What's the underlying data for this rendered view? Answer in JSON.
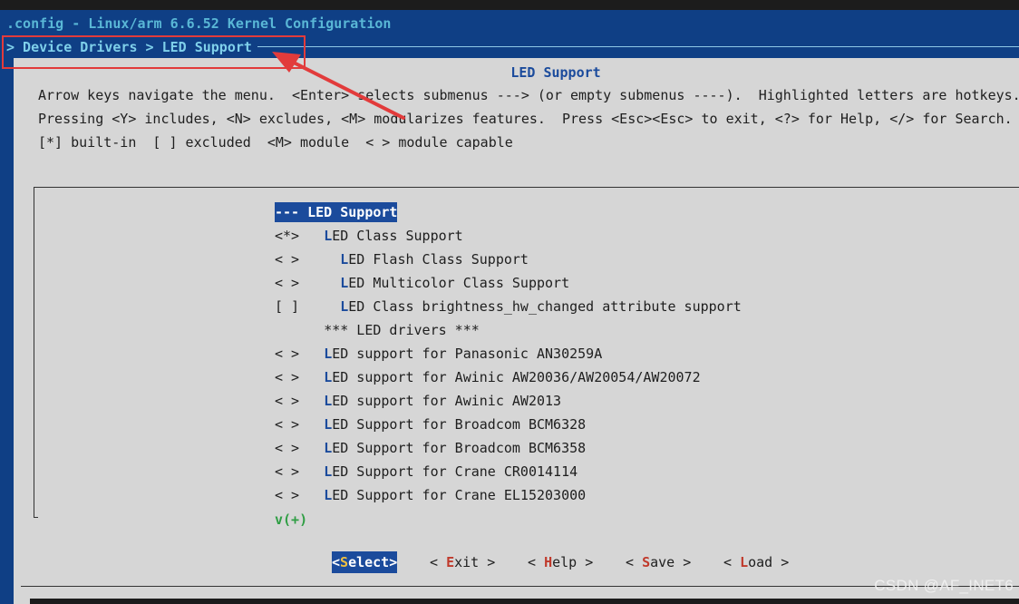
{
  "window": {
    "title": ".config - Linux/arm 6.6.52 Kernel Configuration",
    "breadcrumb": "> Device Drivers > LED Support"
  },
  "dialog": {
    "title": "LED Support",
    "help_lines": [
      "Arrow keys navigate the menu.  <Enter> selects submenus ---> (or empty submenus ----).  Highlighted letters are hotkeys.",
      "Pressing <Y> includes, <N> excludes, <M> modularizes features.  Press <Esc><Esc> to exit, <?> for Help, </> for Search.",
      "[*] built-in  [ ] excluded  <M> module  < > module capable"
    ]
  },
  "menu": {
    "items": [
      {
        "prefix": "--- ",
        "hotkey": "",
        "rest": "LED Support",
        "selected": true
      },
      {
        "prefix": "<*>   ",
        "hotkey": "L",
        "rest": "ED Class Support"
      },
      {
        "prefix": "< >     ",
        "hotkey": "L",
        "rest": "ED Flash Class Support"
      },
      {
        "prefix": "< >     ",
        "hotkey": "L",
        "rest": "ED Multicolor Class Support"
      },
      {
        "prefix": "[ ]     ",
        "hotkey": "L",
        "rest": "ED Class brightness_hw_changed attribute support"
      },
      {
        "prefix": "      ",
        "hotkey": "",
        "rest": "*** LED drivers ***"
      },
      {
        "prefix": "< >   ",
        "hotkey": "L",
        "rest": "ED support for Panasonic AN30259A"
      },
      {
        "prefix": "< >   ",
        "hotkey": "L",
        "rest": "ED support for Awinic AW20036/AW20054/AW20072"
      },
      {
        "prefix": "< >   ",
        "hotkey": "L",
        "rest": "ED support for Awinic AW2013"
      },
      {
        "prefix": "< >   ",
        "hotkey": "L",
        "rest": "ED Support for Broadcom BCM6328"
      },
      {
        "prefix": "< >   ",
        "hotkey": "L",
        "rest": "ED Support for Broadcom BCM6358"
      },
      {
        "prefix": "< >   ",
        "hotkey": "L",
        "rest": "ED Support for Crane CR0014114"
      },
      {
        "prefix": "< >   ",
        "hotkey": "L",
        "rest": "ED Support for Crane EL15203000"
      }
    ],
    "more_indicator": "v(+)"
  },
  "buttons": [
    {
      "pre": "<",
      "hotkey": "S",
      "rest": "elect>",
      "active": true
    },
    {
      "pre": "< ",
      "hotkey": "E",
      "rest": "xit >"
    },
    {
      "pre": "< ",
      "hotkey": "H",
      "rest": "elp >"
    },
    {
      "pre": "< ",
      "hotkey": "S",
      "rest": "ave >"
    },
    {
      "pre": "< ",
      "hotkey": "L",
      "rest": "oad >"
    }
  ],
  "watermark": "CSDN @AF_INET6",
  "colors": {
    "terminal_bg": "#0f3f85",
    "dialog_bg": "#d6d6d6",
    "highlight": "#1b4b9c",
    "button_hotkey": "#c0392b",
    "callout": "#e23b3b"
  }
}
